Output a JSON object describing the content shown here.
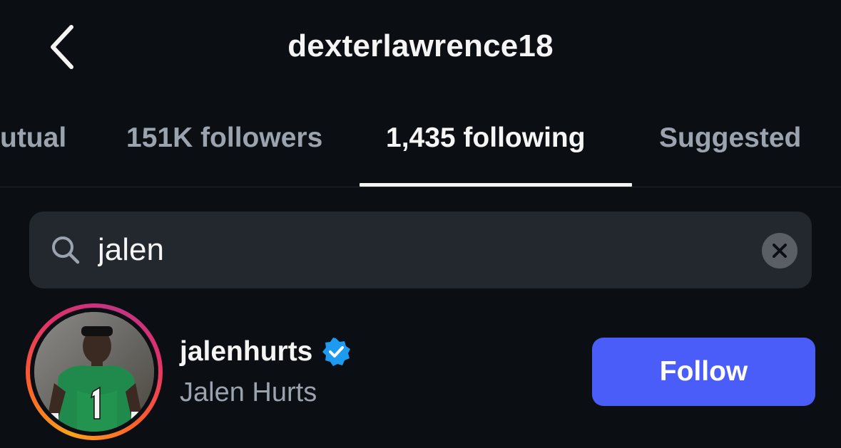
{
  "header": {
    "title": "dexterlawrence18",
    "back_icon": "chevron-left-icon"
  },
  "tabs": [
    {
      "label": "utual",
      "active": false
    },
    {
      "label": "151K followers",
      "active": false
    },
    {
      "label": "1,435 following",
      "active": true
    },
    {
      "label": "Suggested",
      "active": false
    }
  ],
  "search": {
    "value": "jalen",
    "icon": "search-icon",
    "clear_icon": "clear-icon"
  },
  "results": [
    {
      "username": "jalenhurts",
      "verified": true,
      "full_name": "Jalen Hurts",
      "follow_label": "Follow"
    }
  ],
  "colors": {
    "background": "#0b0e12",
    "search_background": "#23282f",
    "follow_button": "#4a5df9",
    "verified_badge": "#1d9bf0",
    "secondary_text": "#9aa3ae"
  }
}
